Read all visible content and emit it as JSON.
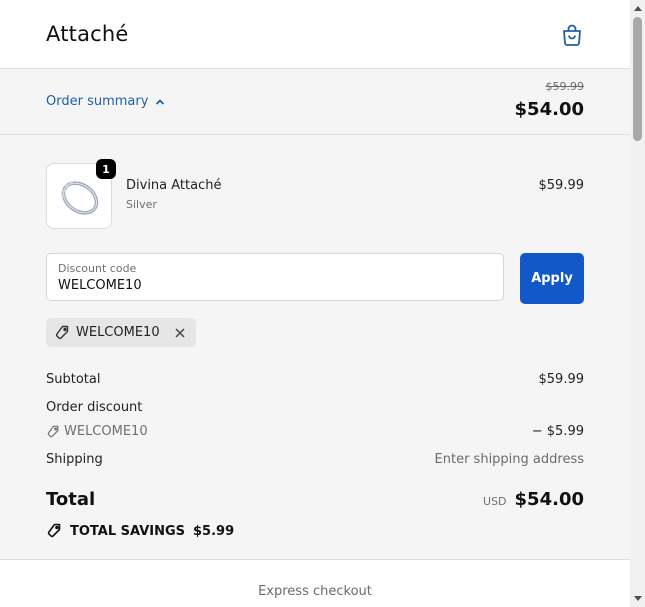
{
  "header": {
    "brand": "Attaché",
    "cart_icon": "shopping-bag-icon"
  },
  "summary_bar": {
    "toggle_label": "Order summary",
    "original_price": "$59.99",
    "total_price": "$54.00"
  },
  "line_item": {
    "quantity": "1",
    "name": "Divina Attaché",
    "variant": "Silver",
    "price": "$59.99"
  },
  "discount": {
    "label": "Discount code",
    "value": "WELCOME10",
    "apply_label": "Apply",
    "applied_code": "WELCOME10"
  },
  "totals": {
    "subtotal_label": "Subtotal",
    "subtotal_value": "$59.99",
    "order_discount_label": "Order discount",
    "discount_code": "WELCOME10",
    "discount_value": "− $5.99",
    "shipping_label": "Shipping",
    "shipping_value": "Enter shipping address",
    "total_label": "Total",
    "currency": "USD",
    "total_value": "$54.00",
    "savings_label": "TOTAL SAVINGS",
    "savings_value": "$5.99"
  },
  "express_checkout": "Express checkout",
  "colors": {
    "accent": "#1358c9",
    "link": "#1f5fa8",
    "panel_bg": "#f5f5f5"
  }
}
